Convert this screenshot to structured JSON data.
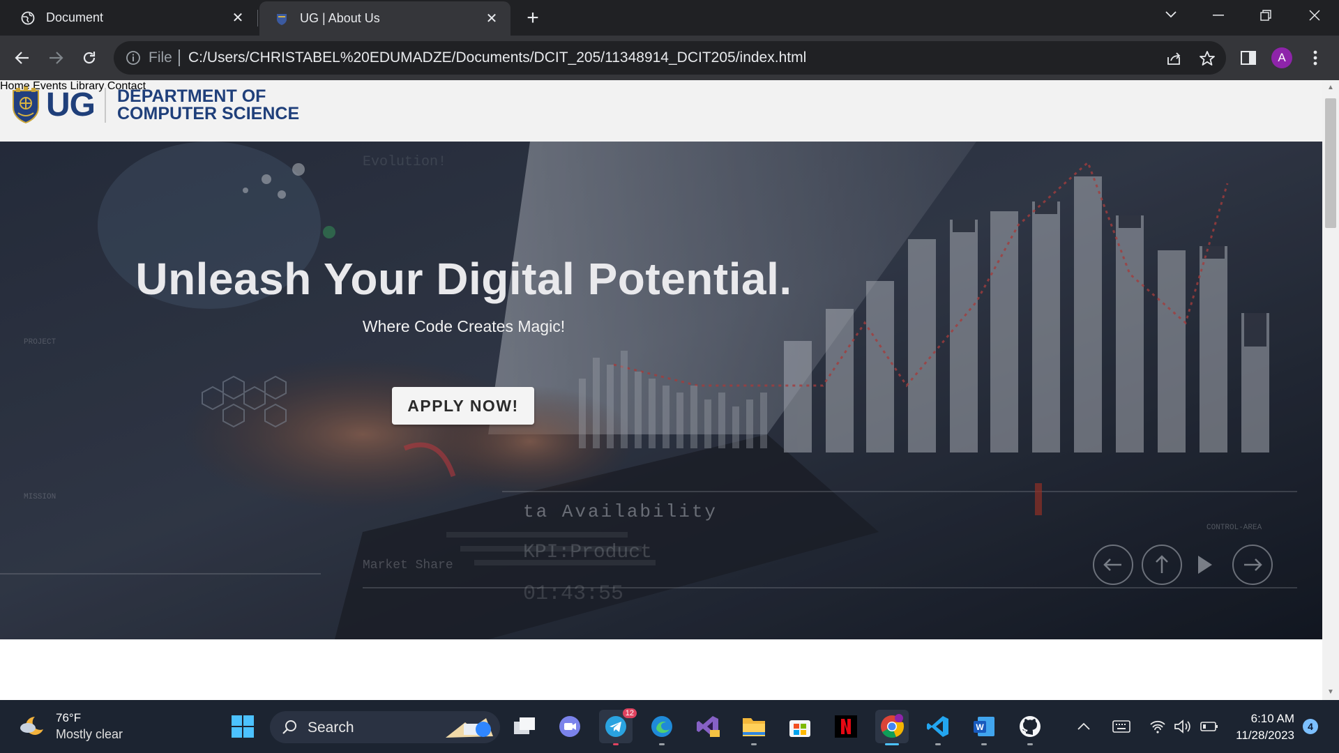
{
  "browser": {
    "tabs": [
      {
        "title": "Document",
        "icon": "globe-icon",
        "active": false
      },
      {
        "title": "UG | About Us",
        "icon": "ug-crest-icon",
        "active": true
      }
    ],
    "address": {
      "scheme_label": "File",
      "url": "C:/Users/CHRISTABEL%20EDUMADZE/Documents/DCIT_205/11348914_DCIT205/index.html"
    },
    "profile_initial": "A",
    "colors": {
      "chrome_dark": "#202124",
      "chrome_toolbar": "#35363a",
      "profile": "#8e24aa"
    }
  },
  "site": {
    "logo": {
      "short": "UG",
      "line1": "DEPARTMENT OF",
      "line2": "COMPUTER SCIENCE"
    },
    "nav": [
      "Home",
      "Events",
      "Library",
      "Contact"
    ],
    "hero": {
      "title": "Unleash Your Digital Potential.",
      "subtitle": "Where Code Creates Magic!",
      "cta": "APPLY NOW!"
    },
    "colors": {
      "brand_blue": "#1f3f7a",
      "header_bg": "#f2f2f2"
    }
  },
  "taskbar": {
    "weather": {
      "temp": "76°F",
      "condition": "Mostly clear"
    },
    "search_label": "Search",
    "telegram_badge": "12",
    "clock": {
      "time": "6:10 AM",
      "date": "11/28/2023"
    },
    "notifications": "4",
    "pinned_icons": [
      "windows-start-icon",
      "task-view-icon",
      "teams-chat-icon",
      "telegram-icon",
      "edge-icon",
      "visual-studio-preview-icon",
      "file-explorer-icon",
      "microsoft-store-icon",
      "netflix-icon",
      "chrome-icon",
      "vscode-icon",
      "word-icon",
      "github-desktop-icon"
    ]
  }
}
